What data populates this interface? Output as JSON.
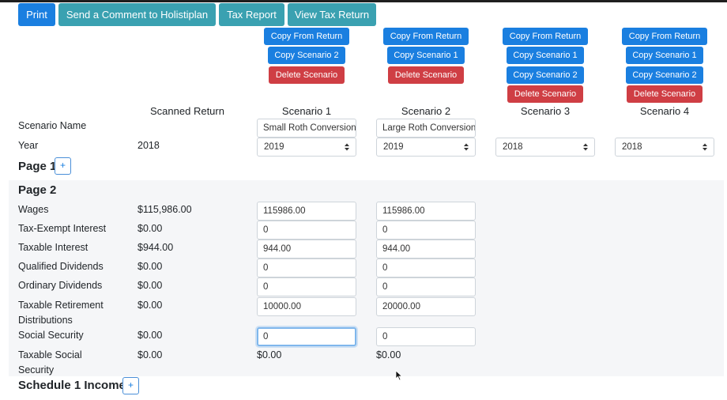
{
  "toolbar": {
    "print": "Print",
    "comment": "Send a Comment to Holistiplan",
    "tax_report": "Tax Report",
    "view_tax_return": "View Tax Return"
  },
  "scenario_buttons": {
    "s1": {
      "copy_from_return": "Copy From Return",
      "copy_other": "Copy Scenario 2",
      "delete": "Delete Scenario"
    },
    "s2": {
      "copy_from_return": "Copy From Return",
      "copy_other": "Copy Scenario 1",
      "delete": "Delete Scenario"
    },
    "s3": {
      "copy_from_return": "Copy From Return",
      "copy_a": "Copy Scenario 1",
      "copy_b": "Copy Scenario 2",
      "delete": "Delete Scenario"
    },
    "s4": {
      "copy_from_return": "Copy From Return",
      "copy_a": "Copy Scenario 1",
      "copy_b": "Copy Scenario 2",
      "delete": "Delete Scenario"
    }
  },
  "columns": {
    "scanned": "Scanned Return",
    "s1": "Scenario 1",
    "s2": "Scenario 2",
    "s3": "Scenario 3",
    "s4": "Scenario 4"
  },
  "scenario_name": {
    "label": "Scenario Name",
    "s1": "Small Roth Conversion",
    "s2": "Large Roth Conversion"
  },
  "year": {
    "label": "Year",
    "scanned": "2018",
    "s1": "2019",
    "s2": "2019",
    "s3": "2018",
    "s4": "2018"
  },
  "sections": {
    "page1": "Page 1",
    "page2": "Page 2",
    "schedule1": "Schedule 1 Income",
    "plus": "+"
  },
  "rows": {
    "wages": {
      "label": "Wages",
      "scanned": "$115,986.00",
      "s1": "115986.00",
      "s2": "115986.00"
    },
    "tax_exempt": {
      "label": "Tax-Exempt Interest",
      "scanned": "$0.00",
      "s1": "0",
      "s2": "0"
    },
    "taxable_interest": {
      "label": "Taxable Interest",
      "scanned": "$944.00",
      "s1": "944.00",
      "s2": "944.00"
    },
    "qualified_div": {
      "label": "Qualified Dividends",
      "scanned": "$0.00",
      "s1": "0",
      "s2": "0"
    },
    "ordinary_div": {
      "label": "Ordinary Dividends",
      "scanned": "$0.00",
      "s1": "0",
      "s2": "0"
    },
    "taxable_retirement": {
      "label_line1": "Taxable Retirement",
      "label_line2": "Distributions",
      "scanned": "$0.00",
      "s1": "10000.00",
      "s2": "20000.00"
    },
    "social_security": {
      "label": "Social Security",
      "scanned": "$0.00",
      "s1": "0",
      "s2": "0"
    },
    "taxable_ss": {
      "label_line1": "Taxable Social",
      "label_line2": "Security",
      "scanned": "$0.00",
      "s1": "$0.00",
      "s2": "$0.00"
    }
  }
}
